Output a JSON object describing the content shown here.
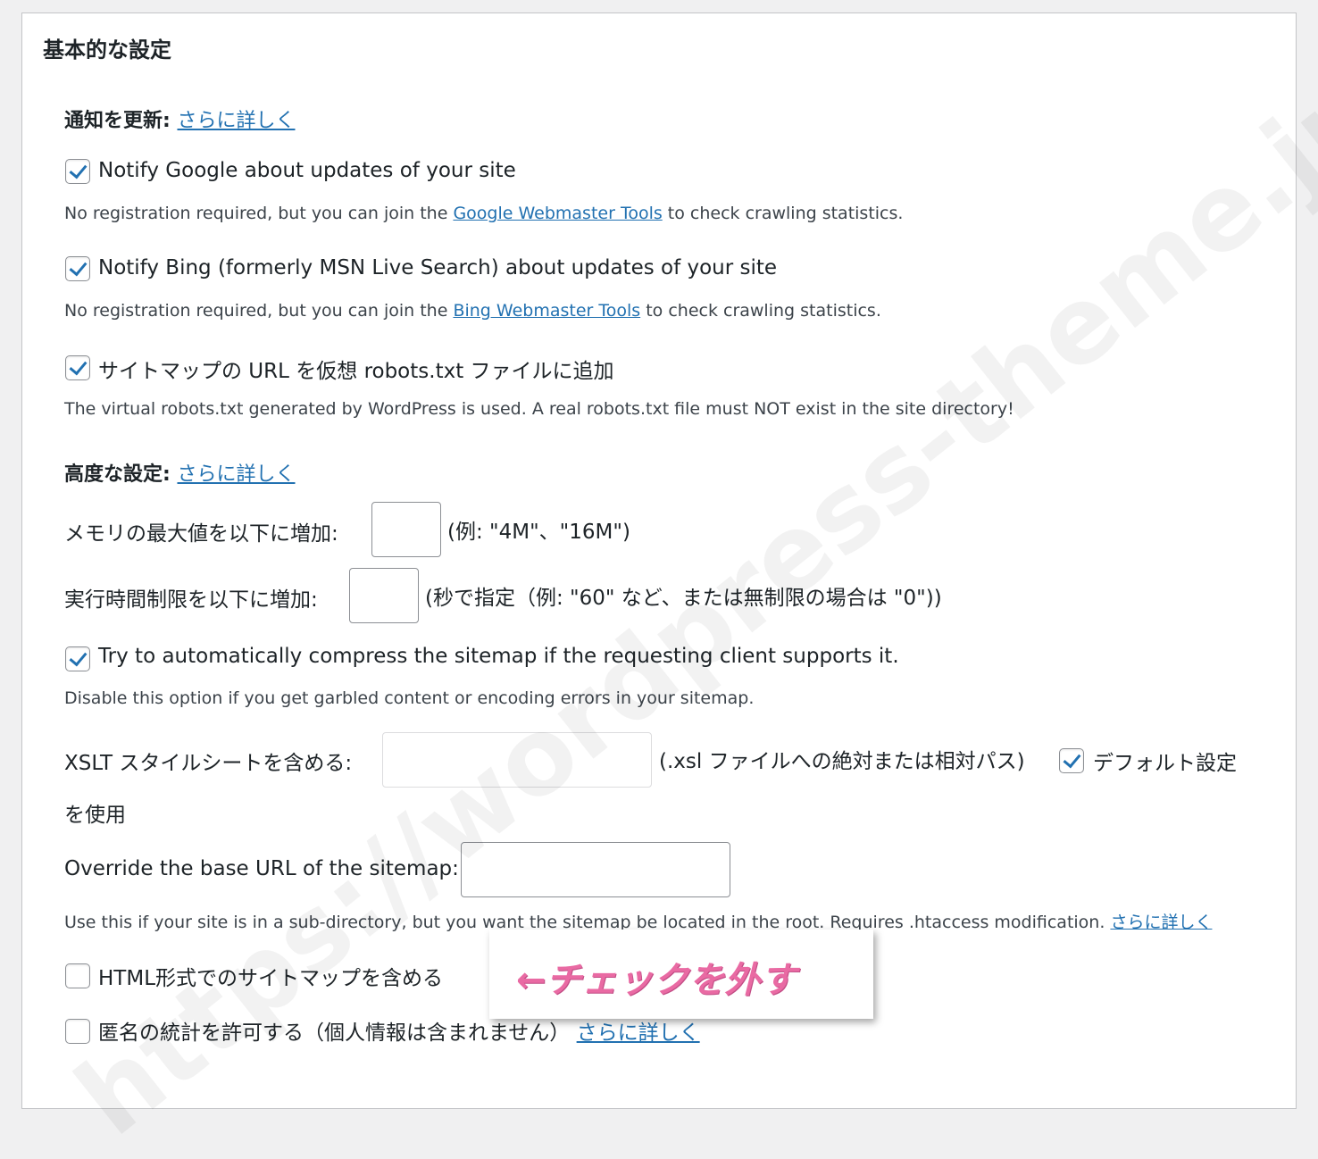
{
  "title": "基本的な設定",
  "notify": {
    "heading": "通知を更新:",
    "more": "さらに詳しく",
    "google": {
      "label": "Notify Google about updates of your site",
      "checked": true,
      "desc_before": "No registration required, but you can join the ",
      "desc_link": "Google Webmaster Tools",
      "desc_after": " to check crawling statistics."
    },
    "bing": {
      "label": "Notify Bing (formerly MSN Live Search) about updates of your site",
      "checked": true,
      "desc_before": "No registration required, but you can join the ",
      "desc_link": "Bing Webmaster Tools",
      "desc_after": " to check crawling statistics."
    },
    "robots": {
      "label": "サイトマップの URL を仮想 robots.txt ファイルに追加",
      "checked": true,
      "desc": "The virtual robots.txt generated by WordPress is used. A real robots.txt file must NOT exist in the site directory!"
    }
  },
  "advanced": {
    "heading": "高度な設定:",
    "more": "さらに詳しく",
    "memory": {
      "label": "メモリの最大値を以下に増加:",
      "value": "",
      "hint": "(例: \"4M\"、\"16M\")"
    },
    "time": {
      "label": "実行時間制限を以下に増加:",
      "value": "",
      "hint": "(秒で指定（例: \"60\" など、または無制限の場合は \"0\"))"
    },
    "compress": {
      "label": "Try to automatically compress the sitemap if the requesting client supports it.",
      "checked": true,
      "desc": "Disable this option if you get garbled content or encoding errors in your sitemap."
    },
    "xslt": {
      "label": "XSLT スタイルシートを含める:",
      "value": "",
      "hint": "(.xsl ファイルへの絶対または相対パス)",
      "default_label_1": "デフォルト設定",
      "default_label_2": "を使用",
      "default_checked": true
    },
    "baseurl": {
      "label": "Override the base URL of the sitemap:",
      "value": "",
      "desc": "Use this if your site is in a sub-directory, but you want the sitemap be located in the root. Requires .htaccess modification.",
      "more": "さらに詳しく"
    },
    "html_sitemap": {
      "label": "HTML形式でのサイトマップを含める",
      "checked": false
    },
    "stats": {
      "label": "匿名の統計を許可する（個人情報は含まれません）",
      "more": "さらに詳しく",
      "checked": false
    }
  },
  "annotation": "←チェックを外す",
  "watermark": "https://wordpress-theme.jp/affinger/",
  "colors": {
    "link": "#2271b1",
    "annotation": "#e96aa3",
    "check": "#2271b1"
  }
}
